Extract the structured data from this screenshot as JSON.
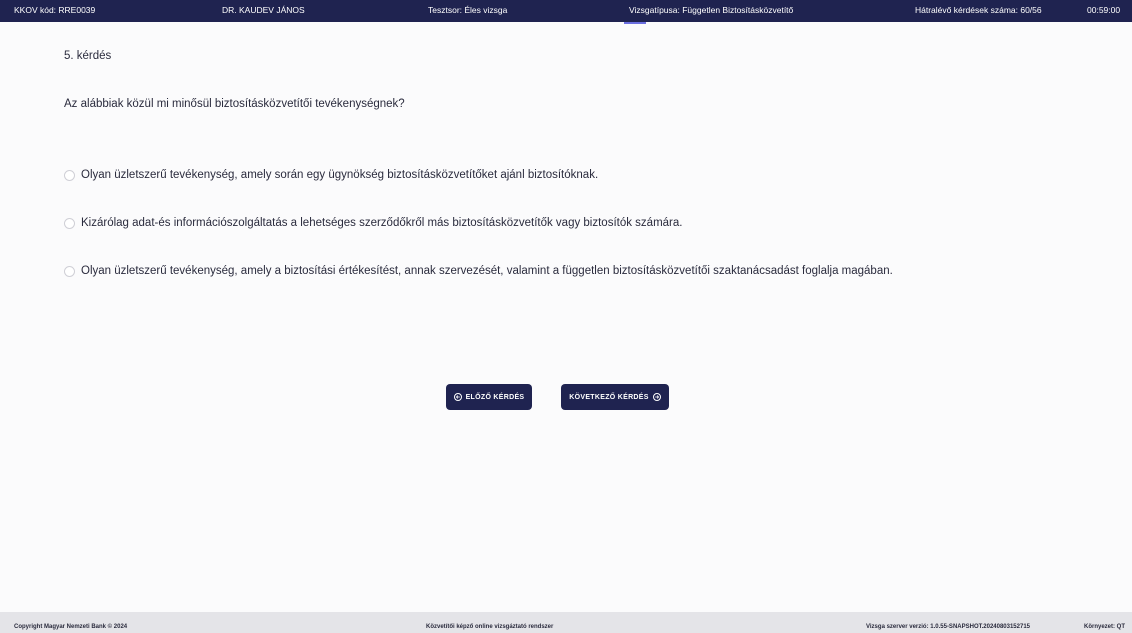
{
  "topbar": {
    "kkov": "KKOV kód: RRE0039",
    "name": "DR. KAUDEV JÁNOS",
    "test_set": "Tesztsor: Éles vizsga",
    "exam_type": "Vizsgatípusa: Független Biztosításközvetítő",
    "remaining": "Hátralévő kérdések száma: 60/56",
    "timer": "00:59:00"
  },
  "question": {
    "number": "5. kérdés",
    "text": "Az alábbiak közül mi minősül biztosításközvetítői tevékenységnek?",
    "answers": [
      {
        "label": "Olyan üzletszerű tevékenység, amely során egy ügynökség biztosításközvetítőket ajánl biztosítóknak.",
        "selected": false
      },
      {
        "label": "Kizárólag adat-és információszolgáltatás a lehetséges szerződőkről más biztosításközvetítők vagy biztosítók számára.",
        "selected": false
      },
      {
        "label": "Olyan üzletszerű tevékenység, amely a biztosítási értékesítést, annak szervezését, valamint a független biztosításközvetítői szaktanácsadást foglalja magában.",
        "selected": false
      }
    ]
  },
  "nav": {
    "prev_label": "ELŐZŐ KÉRDÉS",
    "next_label": "KÖVETKEZŐ KÉRDÉS",
    "prev_icon": "arrow-left-circle-icon",
    "next_icon": "arrow-right-circle-icon"
  },
  "footer": {
    "copyright": "Copyright Magyar Nemzeti Bank © 2024",
    "system": "Közvetítői képző online vizsgáztató rendszer",
    "version": "Vizsga szerver verzió: 1.0.55-SNAPSHOT.20240803152715",
    "environment": "Környezet: QT"
  },
  "colors": {
    "primary": "#1f2350",
    "background": "#fbfbfc",
    "footer_bg": "#e4e4e8",
    "text": "#2a2b3d"
  }
}
